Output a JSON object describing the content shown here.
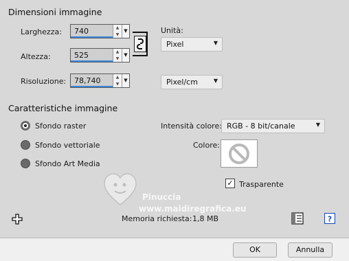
{
  "image_dimensions": {
    "title": "Dimensioni immagine",
    "width_label": "Larghezza:",
    "width_value": "740",
    "height_label": "Altezza:",
    "height_value": "525",
    "resolution_label": "Risoluzione:",
    "resolution_value": "78,740",
    "unit_label": "Unità:",
    "unit_selected": "Pixel",
    "resolution_unit_selected": "Pixel/cm"
  },
  "image_characteristics": {
    "title": "Caratteristiche immagine",
    "background_options": [
      {
        "label": "Sfondo raster",
        "selected": true
      },
      {
        "label": "Sfondo vettoriale",
        "selected": false
      },
      {
        "label": "Sfondo Art Media",
        "selected": false
      }
    ],
    "color_depth_label": "Intensità colore:",
    "color_depth_selected": "RGB - 8 bit/canale",
    "color_label": "Colore:",
    "transparent_label": "Trasparente",
    "transparent_checked": true
  },
  "memory": {
    "label": "Memoria richiesta:",
    "value": "1,8 MB"
  },
  "watermark": {
    "line1": "Pinuccia",
    "line2": "www.maidiregrafica.eu"
  },
  "footer": {
    "ok_label": "OK",
    "cancel_label": "Annulla"
  },
  "colors": {
    "panel_bg": "#d8d8d8",
    "footer_bg": "#f0f0f0",
    "spin_underline": "#3a86d8",
    "help_blue": "#1e4fbf"
  },
  "icons": {
    "link": "chain-link-icon",
    "null_color": "prohibited-circle-icon",
    "presets": "presets-icon",
    "help": "help-icon",
    "move": "move-cross-icon"
  }
}
